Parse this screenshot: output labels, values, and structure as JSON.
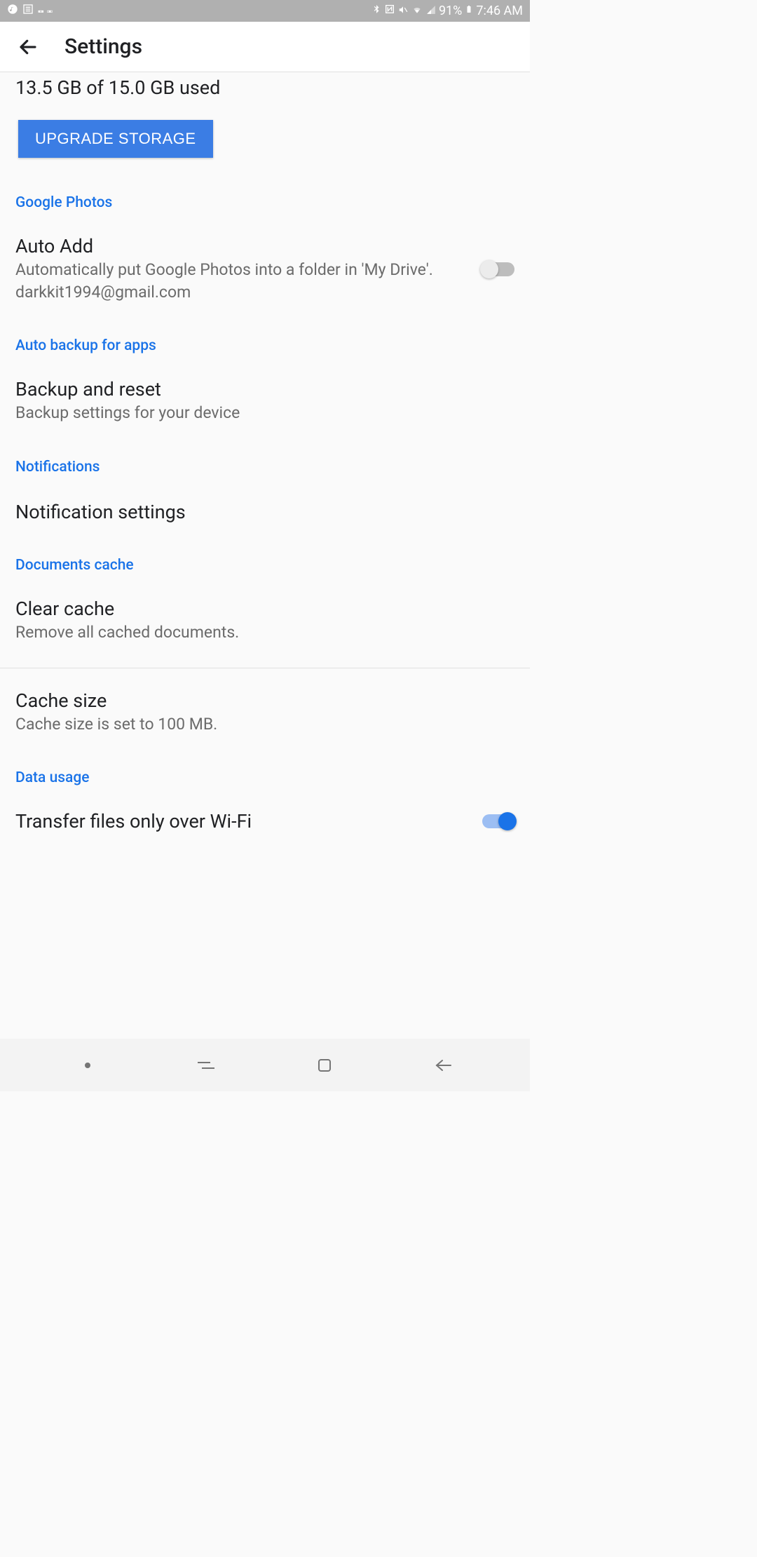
{
  "status": {
    "battery": "91%",
    "time": "7:46 AM"
  },
  "header": {
    "title": "Settings"
  },
  "storage": {
    "text": "13.5 GB of 15.0 GB used",
    "upgrade_label": "UPGRADE STORAGE"
  },
  "sections": {
    "google_photos": {
      "header": "Google Photos",
      "item_title": "Auto Add",
      "item_desc": "Automatically put Google Photos into a folder in 'My Drive'. darkkit1994@gmail.com"
    },
    "auto_backup": {
      "header": "Auto backup for apps",
      "item_title": "Backup and reset",
      "item_desc": "Backup settings for your device"
    },
    "notifications": {
      "header": "Notifications",
      "item_title": "Notification settings"
    },
    "documents_cache": {
      "header": "Documents cache",
      "clear_title": "Clear cache",
      "clear_desc": "Remove all cached documents.",
      "size_title": "Cache size",
      "size_desc": "Cache size is set to 100 MB."
    },
    "data_usage": {
      "header": "Data usage",
      "item_title": "Transfer files only over Wi-Fi"
    }
  }
}
